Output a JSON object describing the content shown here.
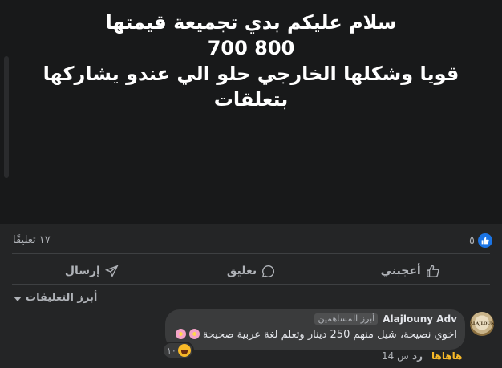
{
  "post": {
    "text_lines": [
      "سلام عليكم بدي تجميعة قيمتها",
      "800 700",
      "قويا وشكلها الخارجي حلو الي عندو يشاركها بتعلقات"
    ]
  },
  "stats": {
    "like_count": "٥",
    "comment_count": "١٧ تعليقًا"
  },
  "actions": {
    "like_label": "أعجبني",
    "comment_label": "تعليق",
    "share_label": "إرسال"
  },
  "comments_header": {
    "label": "أبرز التعليقات"
  },
  "comment": {
    "author": "Alajlouny Adv",
    "role": "أبرز المساهمين",
    "text": "اخوي نصيحة، شيل منهم 250 دينار وتعلم لغة عربية صحيحة",
    "reaction_count": "١٠",
    "time": "14 س",
    "reply_label": "رد",
    "reaction_label": "هاهاها",
    "avatar_text": "ALAJLOUNY"
  },
  "colors": {
    "accent": "#1b74e4",
    "haha": "#f7b928"
  }
}
